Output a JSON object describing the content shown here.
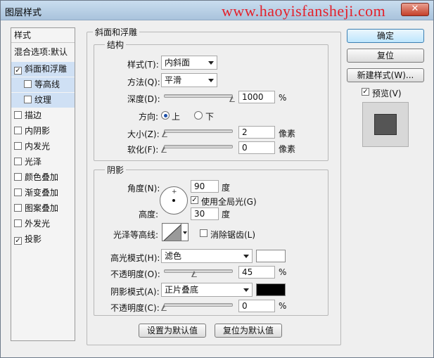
{
  "window": {
    "title": "图层样式",
    "watermark": "www.haoyisfansheji.com",
    "close_glyph": "✕"
  },
  "left_panel": {
    "header": "样式",
    "blend_default": "混合选项:默认",
    "items": [
      {
        "label": "斜面和浮雕",
        "checked": true
      },
      {
        "label": "等高线",
        "checked": false
      },
      {
        "label": "纹理",
        "checked": false
      },
      {
        "label": "描边",
        "checked": false
      },
      {
        "label": "内阴影",
        "checked": false
      },
      {
        "label": "内发光",
        "checked": false
      },
      {
        "label": "光泽",
        "checked": false
      },
      {
        "label": "颜色叠加",
        "checked": false
      },
      {
        "label": "渐变叠加",
        "checked": false
      },
      {
        "label": "图案叠加",
        "checked": false
      },
      {
        "label": "外发光",
        "checked": false
      },
      {
        "label": "投影",
        "checked": true
      }
    ]
  },
  "bevel": {
    "section_title": "斜面和浮雕",
    "structure_title": "结构",
    "style_label": "样式(T):",
    "style_value": "内斜面",
    "technique_label": "方法(Q):",
    "technique_value": "平滑",
    "depth_label": "深度(D):",
    "depth_value": "1000",
    "depth_unit": "%",
    "depth_level": 1.0,
    "direction_label": "方向:",
    "direction_up": "上",
    "direction_down": "下",
    "size_label": "大小(Z):",
    "size_value": "2",
    "size_unit": "像素",
    "size_level": 0.01,
    "soften_label": "软化(F):",
    "soften_value": "0",
    "soften_unit": "像素",
    "soften_level": 0.0
  },
  "shading": {
    "title": "阴影",
    "angle_label": "角度(N):",
    "angle_value": "90",
    "angle_unit": "度",
    "global_light_label": "使用全局光(G)",
    "global_light_checked": true,
    "altitude_label": "高度:",
    "altitude_value": "30",
    "altitude_unit": "度",
    "gloss_label": "光泽等高线:",
    "antialias_label": "消除锯齿(L)",
    "highlight_mode_label": "高光模式(H):",
    "highlight_mode_value": "滤色",
    "highlight_color": "#ffffff",
    "highlight_opacity_label": "不透明度(O):",
    "highlight_opacity_value": "45",
    "highlight_opacity_unit": "%",
    "highlight_opacity_level": 0.45,
    "shadow_mode_label": "阴影模式(A):",
    "shadow_mode_value": "正片叠底",
    "shadow_color": "#000000",
    "shadow_opacity_label": "不透明度(C):",
    "shadow_opacity_value": "0",
    "shadow_opacity_unit": "%",
    "shadow_opacity_level": 0.0
  },
  "footer": {
    "make_default": "设置为默认值",
    "reset_default": "复位为默认值"
  },
  "right_panel": {
    "ok": "确定",
    "reset": "复位",
    "new_style": "新建样式(W)...",
    "preview_label": "预览(V)",
    "preview_checked": true
  }
}
